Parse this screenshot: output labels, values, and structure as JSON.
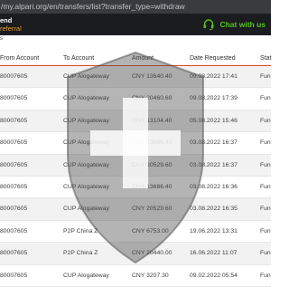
{
  "browser": {
    "url": "/my.alpari.org/en/transfers/list?transfer_type=withdraw"
  },
  "header": {
    "line1": "end",
    "line2": "referral",
    "chat_label": "Chat with us",
    "chat_color": "#52c41a",
    "accent_color": "#e3962a"
  },
  "strip_text": "s",
  "table": {
    "columns": [
      "From Account",
      "To Account",
      "Amount",
      "Date Requested",
      "Stat"
    ],
    "rows": [
      {
        "from": "80007605",
        "to": "CUP Alogateway",
        "amount": "CNY 13640.40",
        "date": "09.08.2022 17:41",
        "status": "Fun"
      },
      {
        "from": "80007605",
        "to": "CUP Alogateway",
        "amount": "CNY 20460.60",
        "date": "09.08.2022 17:39",
        "status": "Fun"
      },
      {
        "from": "80007605",
        "to": "CUP Alogateway",
        "amount": "CNY 13104.40",
        "date": "05.08.2022 15:46",
        "status": "Fun"
      },
      {
        "from": "80007605",
        "to": "CUP Alogateway",
        "amount": "CNY 13686.40",
        "date": "03.08.2022 16:37",
        "status": "Fun"
      },
      {
        "from": "80007605",
        "to": "CUP Alogateway",
        "amount": "CNY 20529.60",
        "date": "03.08.2022 16:37",
        "status": "Fun"
      },
      {
        "from": "80007605",
        "to": "CUP Alogateway",
        "amount": "CNY 13686.40",
        "date": "03.08.2022 16:36",
        "status": "Fun"
      },
      {
        "from": "80007605",
        "to": "CUP Alogateway",
        "amount": "CNY 20529.60",
        "date": "03.08.2022 16:35",
        "status": "Fun"
      },
      {
        "from": "80007605",
        "to": "P2P China Z",
        "amount": "CNY 6753.00",
        "date": "19.06.2022 13:31",
        "status": "Fun"
      },
      {
        "from": "80007605",
        "to": "P2P China Z",
        "amount": "CNY 20440.00",
        "date": "16.06.2022 11:07",
        "status": "Fun"
      },
      {
        "from": "80007605",
        "to": "CUP Alogateway",
        "amount": "CNY 3207.30",
        "date": "09.02.2022 05:54",
        "status": "Fun"
      }
    ]
  },
  "colors": {
    "divider": "#e0452e",
    "row_alt": "#f2f2f2",
    "watermark": "#4d4d4d"
  },
  "watermark_icon": "shield-cross-watermark"
}
